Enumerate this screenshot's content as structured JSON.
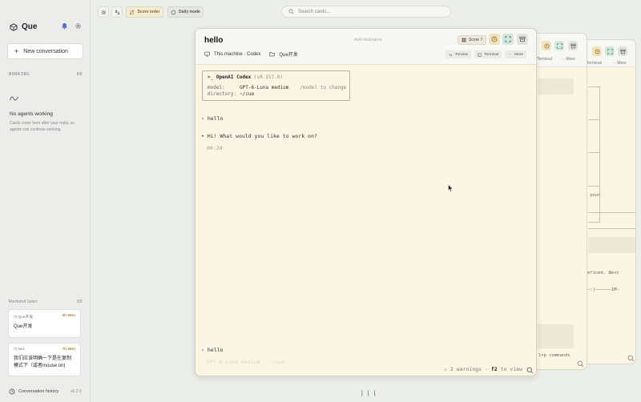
{
  "sidebar": {
    "brand": "Que",
    "new_conversation": "New conversation",
    "working_label": "WORKING",
    "working_count": "00",
    "empty_title": "No agents working",
    "empty_desc": "Cards come here after your reply, so agents can continue working.",
    "remind_label": "Remind later",
    "remind_count": "05",
    "remind_items": [
      {
        "source": "Que开发",
        "time": "2h 58m",
        "title": "Que开发"
      },
      {
        "source": "ssd",
        "time": "7h 58m",
        "title": "我们应该明确一下是在复制模式下（或者mouse on)"
      }
    ],
    "footer_history": "Conversation history",
    "version": "v0.2.0"
  },
  "toolbar": {
    "score_order": "Score order",
    "daily_mode": "Daily mode",
    "search_placeholder": "Search cards..."
  },
  "main_card": {
    "title": "hello",
    "nickname_placeholder": "Add nickname",
    "score": "Score 7",
    "machine": "This machine · Codex",
    "folder": "Que开发",
    "actions": {
      "review": "Review",
      "terminal": "Terminal",
      "more": "More"
    },
    "codex": {
      "prompt": ">_",
      "name": "OpenAI Codex",
      "version": "(v0.157.0)",
      "model_key": "model:",
      "model_value": "GPT-6-Luna medium",
      "model_hint": "/model to change",
      "dir_key": "directory:",
      "dir_value": "~/cue"
    },
    "lines": {
      "user1": "› hello",
      "assistant1": "• Hi! What would you like to work on?",
      "timestamp": "00:24",
      "user2": "› hello",
      "footer_dim": "GPT-6-Luna medium · ~/cue"
    },
    "status_prefix": "⚠ 2 warnings ·",
    "status_key": "f2",
    "status_suffix": "to view"
  },
  "back_card_1": {
    "terminal": "Terminal",
    "more": "More",
    "text_commands": "l+p commands"
  },
  "back_card_2": {
    "terminal": "Terminal",
    "more": "More",
    "text_your": "your",
    "text_defined": "efined. Next",
    "text_1m": "1M"
  },
  "bottom_handle": "| | |",
  "colors": {
    "card_bg": "#fbf6e3",
    "amber_accent": "#b08a3a",
    "green_accent": "#4e9b7a"
  }
}
